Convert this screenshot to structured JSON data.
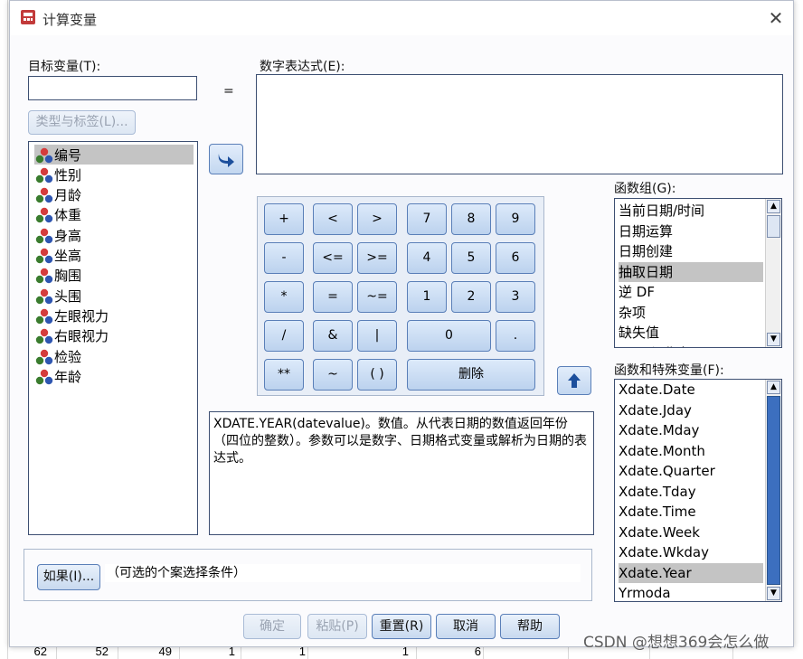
{
  "background_sheet": {
    "cells": [
      "62",
      "52",
      "49",
      "1",
      "1",
      "1",
      "6"
    ]
  },
  "dialog": {
    "title": "计算变量",
    "target_label": "目标变量(T):",
    "target_value": "",
    "equals": "=",
    "numeric_expr_label": "数字表达式(E):",
    "numeric_expr_value": "",
    "type_label_button": "类型与标签(L)...",
    "variables": [
      {
        "label": "编号",
        "selected": true
      },
      {
        "label": "性别",
        "selected": false
      },
      {
        "label": "月龄",
        "selected": false
      },
      {
        "label": "体重",
        "selected": false
      },
      {
        "label": "身高",
        "selected": false
      },
      {
        "label": "坐高",
        "selected": false
      },
      {
        "label": "胸围",
        "selected": false
      },
      {
        "label": "头围",
        "selected": false
      },
      {
        "label": "左眼视力",
        "selected": false
      },
      {
        "label": "右眼视力",
        "selected": false
      },
      {
        "label": "检验",
        "selected": false
      },
      {
        "label": "年龄",
        "selected": false
      }
    ],
    "keypad": {
      "plus": "+",
      "lt": "<",
      "gt": ">",
      "k7": "7",
      "k8": "8",
      "k9": "9",
      "minus": "-",
      "le": "<=",
      "ge": ">=",
      "k4": "4",
      "k5": "5",
      "k6": "6",
      "mul": "*",
      "eq": "=",
      "ne": "~=",
      "k1": "1",
      "k2": "2",
      "k3": "3",
      "div": "/",
      "and": "&",
      "or": "|",
      "k0": "0",
      "dot": ".",
      "pow": "**",
      "not": "~",
      "paren": "( )",
      "delete": "删除"
    },
    "description": "XDATE.YEAR(datevalue)。数值。从代表日期的数值返回年份（四位的整数）。参数可以是数字、日期格式变量或解析为日期的表达式。",
    "function_group_label": "函数组(G):",
    "function_groups": [
      {
        "label": "当前日期/时间",
        "selected": false
      },
      {
        "label": "日期运算",
        "selected": false
      },
      {
        "label": "日期创建",
        "selected": false
      },
      {
        "label": "抽取日期",
        "selected": true
      },
      {
        "label": "逆 DF",
        "selected": false
      },
      {
        "label": "杂项",
        "selected": false
      },
      {
        "label": "缺失值",
        "selected": false
      },
      {
        "label": "PDF 与非中心 PDF",
        "selected": false
      }
    ],
    "functions_label": "函数和特殊变量(F):",
    "functions": [
      {
        "label": "Xdate.Date",
        "selected": false
      },
      {
        "label": "Xdate.Jday",
        "selected": false
      },
      {
        "label": "Xdate.Mday",
        "selected": false
      },
      {
        "label": "Xdate.Month",
        "selected": false
      },
      {
        "label": "Xdate.Quarter",
        "selected": false
      },
      {
        "label": "Xdate.Tday",
        "selected": false
      },
      {
        "label": "Xdate.Time",
        "selected": false
      },
      {
        "label": "Xdate.Week",
        "selected": false
      },
      {
        "label": "Xdate.Wkday",
        "selected": false
      },
      {
        "label": "Xdate.Year",
        "selected": true
      },
      {
        "label": "Yrmoda",
        "selected": false
      }
    ],
    "if_button": "如果(I)...",
    "if_condition": "（可选的个案选择条件）",
    "buttons": {
      "ok": "确定",
      "paste": "粘贴(P)",
      "reset": "重置(R)",
      "cancel": "取消",
      "help": "帮助"
    }
  },
  "watermark": "CSDN @想想369会怎么做",
  "colors": {
    "selection": "#c4c4c4",
    "button_border": "#5a7fb8",
    "field_border": "#3d4f72"
  }
}
